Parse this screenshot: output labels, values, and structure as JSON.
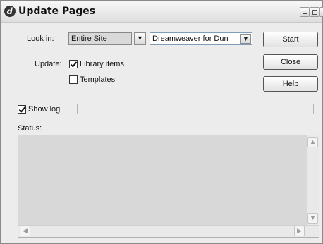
{
  "window": {
    "title": "Update Pages"
  },
  "form": {
    "look_in_label": "Look in:",
    "look_in_value": "Entire Site",
    "site_value": "Dreamweaver for Dun",
    "update_label": "Update:",
    "library_items_label": "Library items",
    "library_items_checked": true,
    "templates_label": "Templates",
    "templates_checked": false,
    "show_log_label": "Show log",
    "show_log_checked": true,
    "status_label": "Status:"
  },
  "buttons": {
    "start": "Start",
    "close": "Close",
    "help": "Help"
  },
  "icons": {
    "app": "dreamweaver-logo-icon",
    "dropdown": "chevron-down-icon",
    "scroll_up": "arrow-up-icon",
    "scroll_down": "arrow-down-icon",
    "scroll_left": "arrow-left-icon",
    "scroll_right": "arrow-right-icon"
  }
}
